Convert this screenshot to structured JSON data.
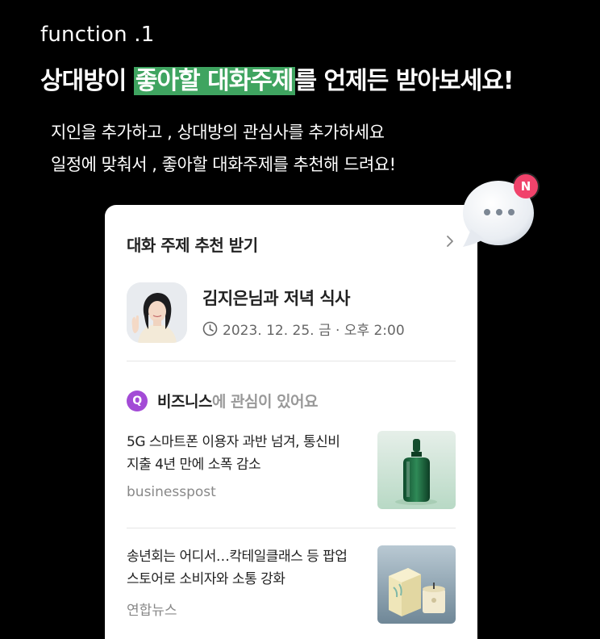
{
  "section_label": "function .1",
  "headline": {
    "part1": "상대방이 ",
    "highlight": "좋아할 대화주제",
    "part2": "를 언제든 받아보세요!"
  },
  "subtext": {
    "line1": "지인을 추가하고 , 상대방의 관심사를 추가하세요",
    "line2": "일정에 맞춰서 ,  좋아할 대화주제를 추천해 드려요!"
  },
  "notification": {
    "badge": "N",
    "icon": "chat-bubble-icon"
  },
  "card": {
    "header": "대화 주제 추천 받기",
    "event": {
      "title": "김지은님과 저녁 식사",
      "datetime": "2023. 12. 25. 금 · 오후 2:00"
    },
    "topic": {
      "badge": "Q",
      "keyword": "비즈니스",
      "suffix": "에 관심이 있어요"
    },
    "news": [
      {
        "title_line1": "5G 스마트폰 이용자 과반 넘겨, 통신비",
        "title_line2": "지출 4년 만에 소폭 감소",
        "source": "businesspost"
      },
      {
        "title_line1": "송년회는 어디서…칵테일클래스 등 팝업",
        "title_line2": "스토어로 소비자와 소통 강화",
        "source": "연합뉴스"
      }
    ]
  },
  "colors": {
    "highlight": "#3fa460",
    "badge_pink": "#f0436b",
    "badge_purple": "#a34bd6"
  }
}
